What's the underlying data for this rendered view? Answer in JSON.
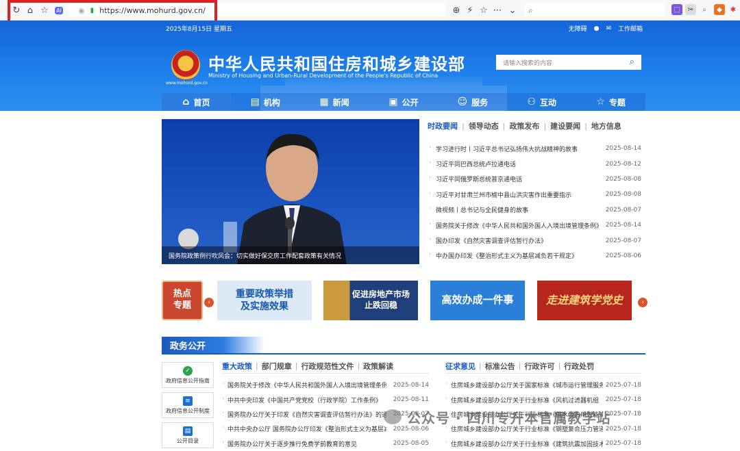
{
  "browser": {
    "url": "https://www.mohurd.gov.cn/",
    "colors": {
      "frame": "#e02020"
    }
  },
  "header": {
    "date": "2025年8月15日 星期五",
    "links": [
      "无障碍",
      "工作邮箱"
    ],
    "site_url": "www.mohurd.gov.cn",
    "title": "中华人民共和国住房和城乡建设部",
    "subtitle": "Ministry of Housing and Urban-Rural Development of the People's Republic of China",
    "search_placeholder": "请输入搜索的内容"
  },
  "nav": [
    {
      "label": "首页",
      "icon": "home-icon"
    },
    {
      "label": "机构",
      "icon": "building-icon"
    },
    {
      "label": "新闻",
      "icon": "newspaper-icon"
    },
    {
      "label": "公开",
      "icon": "document-icon"
    },
    {
      "label": "服务",
      "icon": "service-icon"
    },
    {
      "label": "互动",
      "icon": "interact-icon"
    },
    {
      "label": "专题",
      "icon": "star-icon"
    }
  ],
  "hero": {
    "caption": "国务院政策例行吹风会：切实做好保交房工作配套政策有关情况"
  },
  "news": {
    "tabs": [
      "时政要闻",
      "领导动态",
      "政策发布",
      "建设要闻",
      "地方信息"
    ],
    "items": [
      {
        "title": "学习进行时丨习近平总书记弘扬伟大抗战精神的故事",
        "date": "2025-08-14"
      },
      {
        "title": "习近平同巴西总统卢拉通电话",
        "date": "2025-08-12"
      },
      {
        "title": "习近平同俄罗斯总统普京通电话",
        "date": "2025-08-08"
      },
      {
        "title": "习近平对甘肃兰州市榆中县山洪灾害作出重要指示",
        "date": "2025-08-08"
      },
      {
        "title": "微视频丨总书记与全民健身的故事",
        "date": "2025-08-07"
      },
      {
        "title": "国务院关于修改《中华人民共和国外国人入境出境管理条例》…",
        "date": "2025-08-14"
      },
      {
        "title": "国办印发《自然灾害调查评估暂行办法》",
        "date": "2025-08-07"
      },
      {
        "title": "中办国办印发《整治形式主义为基层减负若干规定》",
        "date": "2025-08-06"
      }
    ]
  },
  "topics": {
    "main": "热点\n专题",
    "cards": [
      {
        "text": "重要政策举措\n及实施效果",
        "bg": "#dce9f7",
        "fg": "#1b5aa8"
      },
      {
        "text": "促进房地产市场\n止跌回稳",
        "bg": "#1f3f7a",
        "fg": "#ffffff"
      },
      {
        "text": "高效办成一件事",
        "bg": "#2b7fd6",
        "fg": "#ffffff"
      },
      {
        "text": "走进建筑学党史",
        "bg": "#b7261c",
        "fg": "#f6d37a"
      }
    ]
  },
  "gov": {
    "title": "政务公开",
    "side": [
      {
        "label": "政府信息公开指南",
        "icon": "guide-icon",
        "color": "#2aa34a"
      },
      {
        "label": "政府信息公开制度",
        "icon": "rules-icon",
        "color": "#1b6fd1"
      },
      {
        "label": "公开目录",
        "icon": "catalog-icon",
        "color": "#1b6fd1"
      }
    ],
    "left": {
      "tabs": [
        "重大政策",
        "部门规章",
        "行政规范性文件",
        "政策解读"
      ],
      "items": [
        {
          "title": "国务院关于修改《中华人民共和国外国人入境出境管理条例…",
          "date": "2025-08-14"
        },
        {
          "title": "中共中央印发《中国共产党党校（行政学院）工作条例》",
          "date": "2025-08-11"
        },
        {
          "title": "国务院办公厅关于印发《自然灾害调查评估暂行办法》的通知",
          "date": "2025-08-07"
        },
        {
          "title": "中共中央办公厅 国务院办公厅印发《整治形式主义为基层减…",
          "date": "2025-08-06"
        },
        {
          "title": "国务院办公厅关于逐步推行免费学前教育的意见",
          "date": "2025-08-05"
        }
      ]
    },
    "right": {
      "tabs": [
        "征求意见",
        "标准公告",
        "行政许可",
        "行政处罚"
      ],
      "items": [
        {
          "title": "住房城乡建设部办公厅关于国家标准《城市运行管理服务…",
          "date": "2025-07-18"
        },
        {
          "title": "住房城乡建设部办公厅关于行业标准《风机过滤器机组（…",
          "date": "2025-07-18"
        },
        {
          "title": "住房城乡建设部办公厅关于行业标准《供水供热用智能流…",
          "date": "2025-07-18"
        },
        {
          "title": "住房城乡建设部办公厅关于行业标准《钢塑复合压力管道…",
          "date": "2025-07-18"
        },
        {
          "title": "住房城乡建设部办公厅关于行业标准《建筑抗震加固技术…",
          "date": "2025-07-18"
        }
      ]
    }
  },
  "watermark": "公众号 · 四川专升本官属教学站"
}
